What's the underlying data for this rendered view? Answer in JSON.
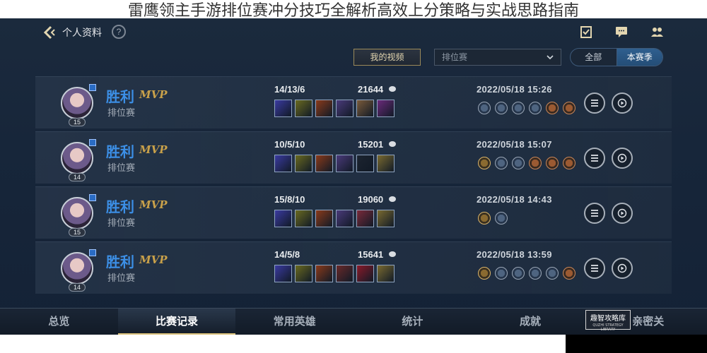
{
  "article_title": "雷鹰领主手游排位赛冲分技巧全解析高效上分策略与实战思路指南",
  "header": {
    "title": "个人资料",
    "help_glyph": "?"
  },
  "filters": {
    "my_video_label": "我的视频",
    "mode_select_value": "排位赛",
    "segments": [
      "全部",
      "本赛季"
    ],
    "active_segment": "本赛季"
  },
  "matches": [
    {
      "result": "胜利",
      "mvp": "MVP",
      "mode": "排位赛",
      "level": "15",
      "kda": "14/13/6",
      "score": "21644",
      "date": "2022/05/18 15:26",
      "items": 6,
      "runes": [
        "blue",
        "blue",
        "blue",
        "blue",
        "bronze",
        "bronze"
      ]
    },
    {
      "result": "胜利",
      "mvp": "MVP",
      "mode": "排位赛",
      "level": "14",
      "kda": "10/5/10",
      "score": "15201",
      "date": "2022/05/18 15:07",
      "items": 6,
      "runes": [
        "gold",
        "blue",
        "blue",
        "bronze",
        "bronze",
        "bronze"
      ]
    },
    {
      "result": "胜利",
      "mvp": "MVP",
      "mode": "排位赛",
      "level": "15",
      "kda": "15/8/10",
      "score": "19060",
      "date": "2022/05/18 14:43",
      "items": 6,
      "runes": [
        "gold",
        "blue"
      ]
    },
    {
      "result": "胜利",
      "mvp": "MVP",
      "mode": "排位赛",
      "level": "14",
      "kda": "14/5/8",
      "score": "15641",
      "date": "2022/05/18 13:59",
      "items": 6,
      "runes": [
        "gold",
        "blue",
        "blue",
        "blue",
        "blue",
        "bronze"
      ]
    }
  ],
  "nav": [
    "总览",
    "比赛记录",
    "常用英雄",
    "统计",
    "成就",
    "亲密关"
  ],
  "active_nav": "比赛记录",
  "watermark": {
    "text": "趣智攻略库",
    "subtext": "QUZHI STRATEGY LIBRARY"
  },
  "colors": {
    "victory": "#3c8fe6",
    "mvp": "#c9a14a",
    "accent_gold": "#d9c07a"
  }
}
